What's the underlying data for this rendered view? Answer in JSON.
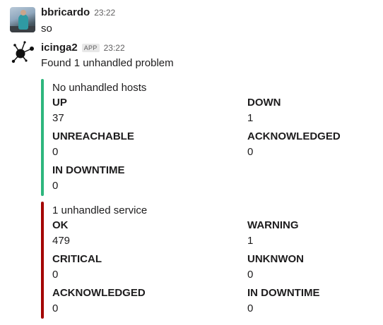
{
  "messages": {
    "user": {
      "name": "bbricardo",
      "time": "23:22",
      "text": "so"
    },
    "bot": {
      "name": "icinga2",
      "badge": "APP",
      "time": "23:22",
      "text": "Found 1 unhandled problem"
    }
  },
  "hosts": {
    "title": "No unhandled hosts",
    "color": "#2eb67d",
    "fields": [
      {
        "label": "UP",
        "value": "37"
      },
      {
        "label": "DOWN",
        "value": "1"
      },
      {
        "label": "UNREACHABLE",
        "value": "0"
      },
      {
        "label": "ACKNOWLEDGED",
        "value": "0"
      },
      {
        "label": "IN DOWNTIME",
        "value": "0"
      }
    ]
  },
  "services": {
    "title": "1 unhandled service",
    "color": "#a30200",
    "fields": [
      {
        "label": "OK",
        "value": "479"
      },
      {
        "label": "WARNING",
        "value": "1"
      },
      {
        "label": "CRITICAL",
        "value": "0"
      },
      {
        "label": "UNKNWON",
        "value": "0"
      },
      {
        "label": "ACKNOWLEDGED",
        "value": "0"
      },
      {
        "label": "IN DOWNTIME",
        "value": "0"
      }
    ]
  }
}
